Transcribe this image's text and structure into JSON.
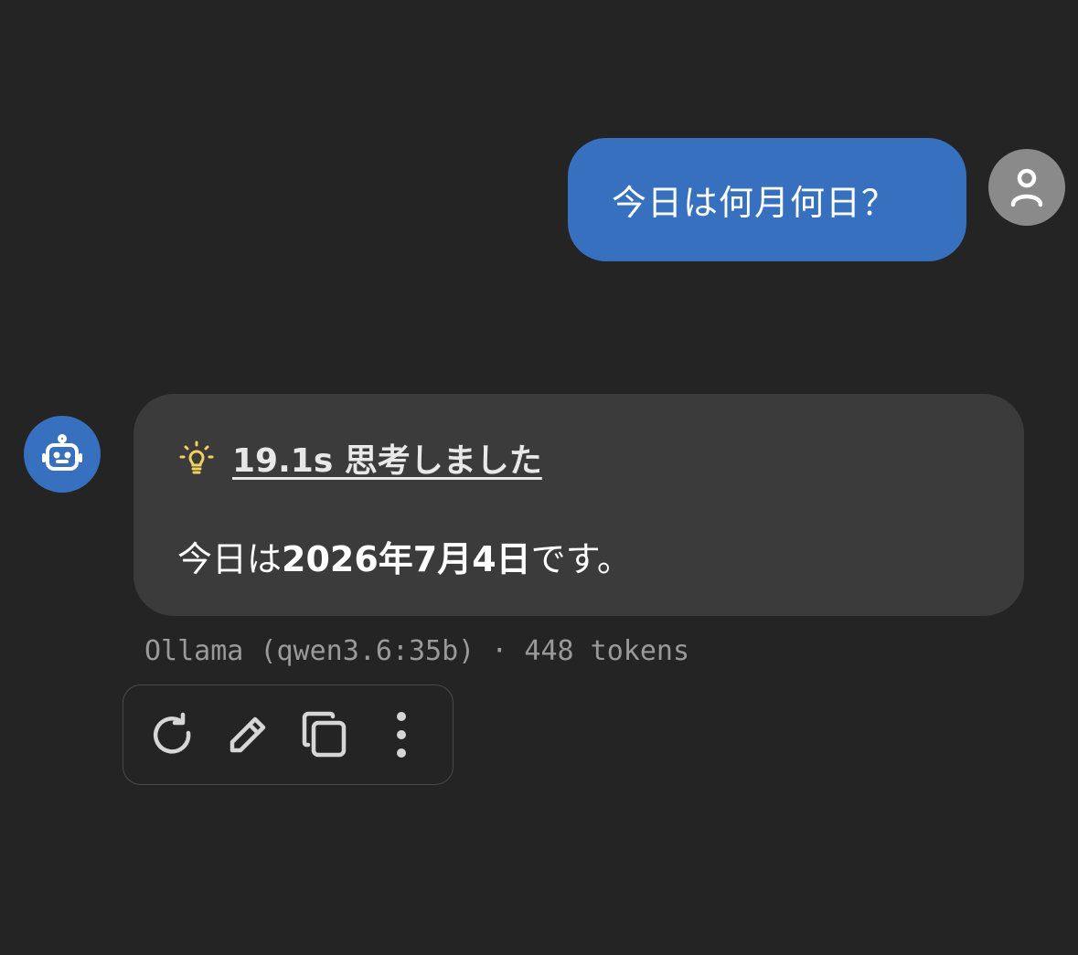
{
  "conversation": {
    "user_message": {
      "text": "今日は何月何日？",
      "avatar_icon": "user-icon"
    },
    "assistant_message": {
      "avatar_icon": "robot-icon",
      "thinking": {
        "icon": "lightbulb-icon",
        "label": "19.1s 思考しました"
      },
      "answer": {
        "prefix": "今日は",
        "emphasis": "2026年7月4日",
        "suffix": "です。"
      },
      "meta": "Ollama (qwen3.6:35b) · 448 tokens",
      "actions": [
        {
          "name": "regenerate",
          "icon": "refresh-icon"
        },
        {
          "name": "edit",
          "icon": "pencil-icon"
        },
        {
          "name": "copy",
          "icon": "copy-icon"
        },
        {
          "name": "more",
          "icon": "more-vertical-icon"
        }
      ]
    }
  },
  "colors": {
    "background": "#242424",
    "user_bubble": "#3770be",
    "assistant_bubble": "#3b3b3b",
    "user_avatar": "#8a8a8a",
    "bot_avatar": "#3770be",
    "bulb": "#f2d15c",
    "meta_text": "#9a9a9a",
    "icon": "#d6d6d6"
  }
}
